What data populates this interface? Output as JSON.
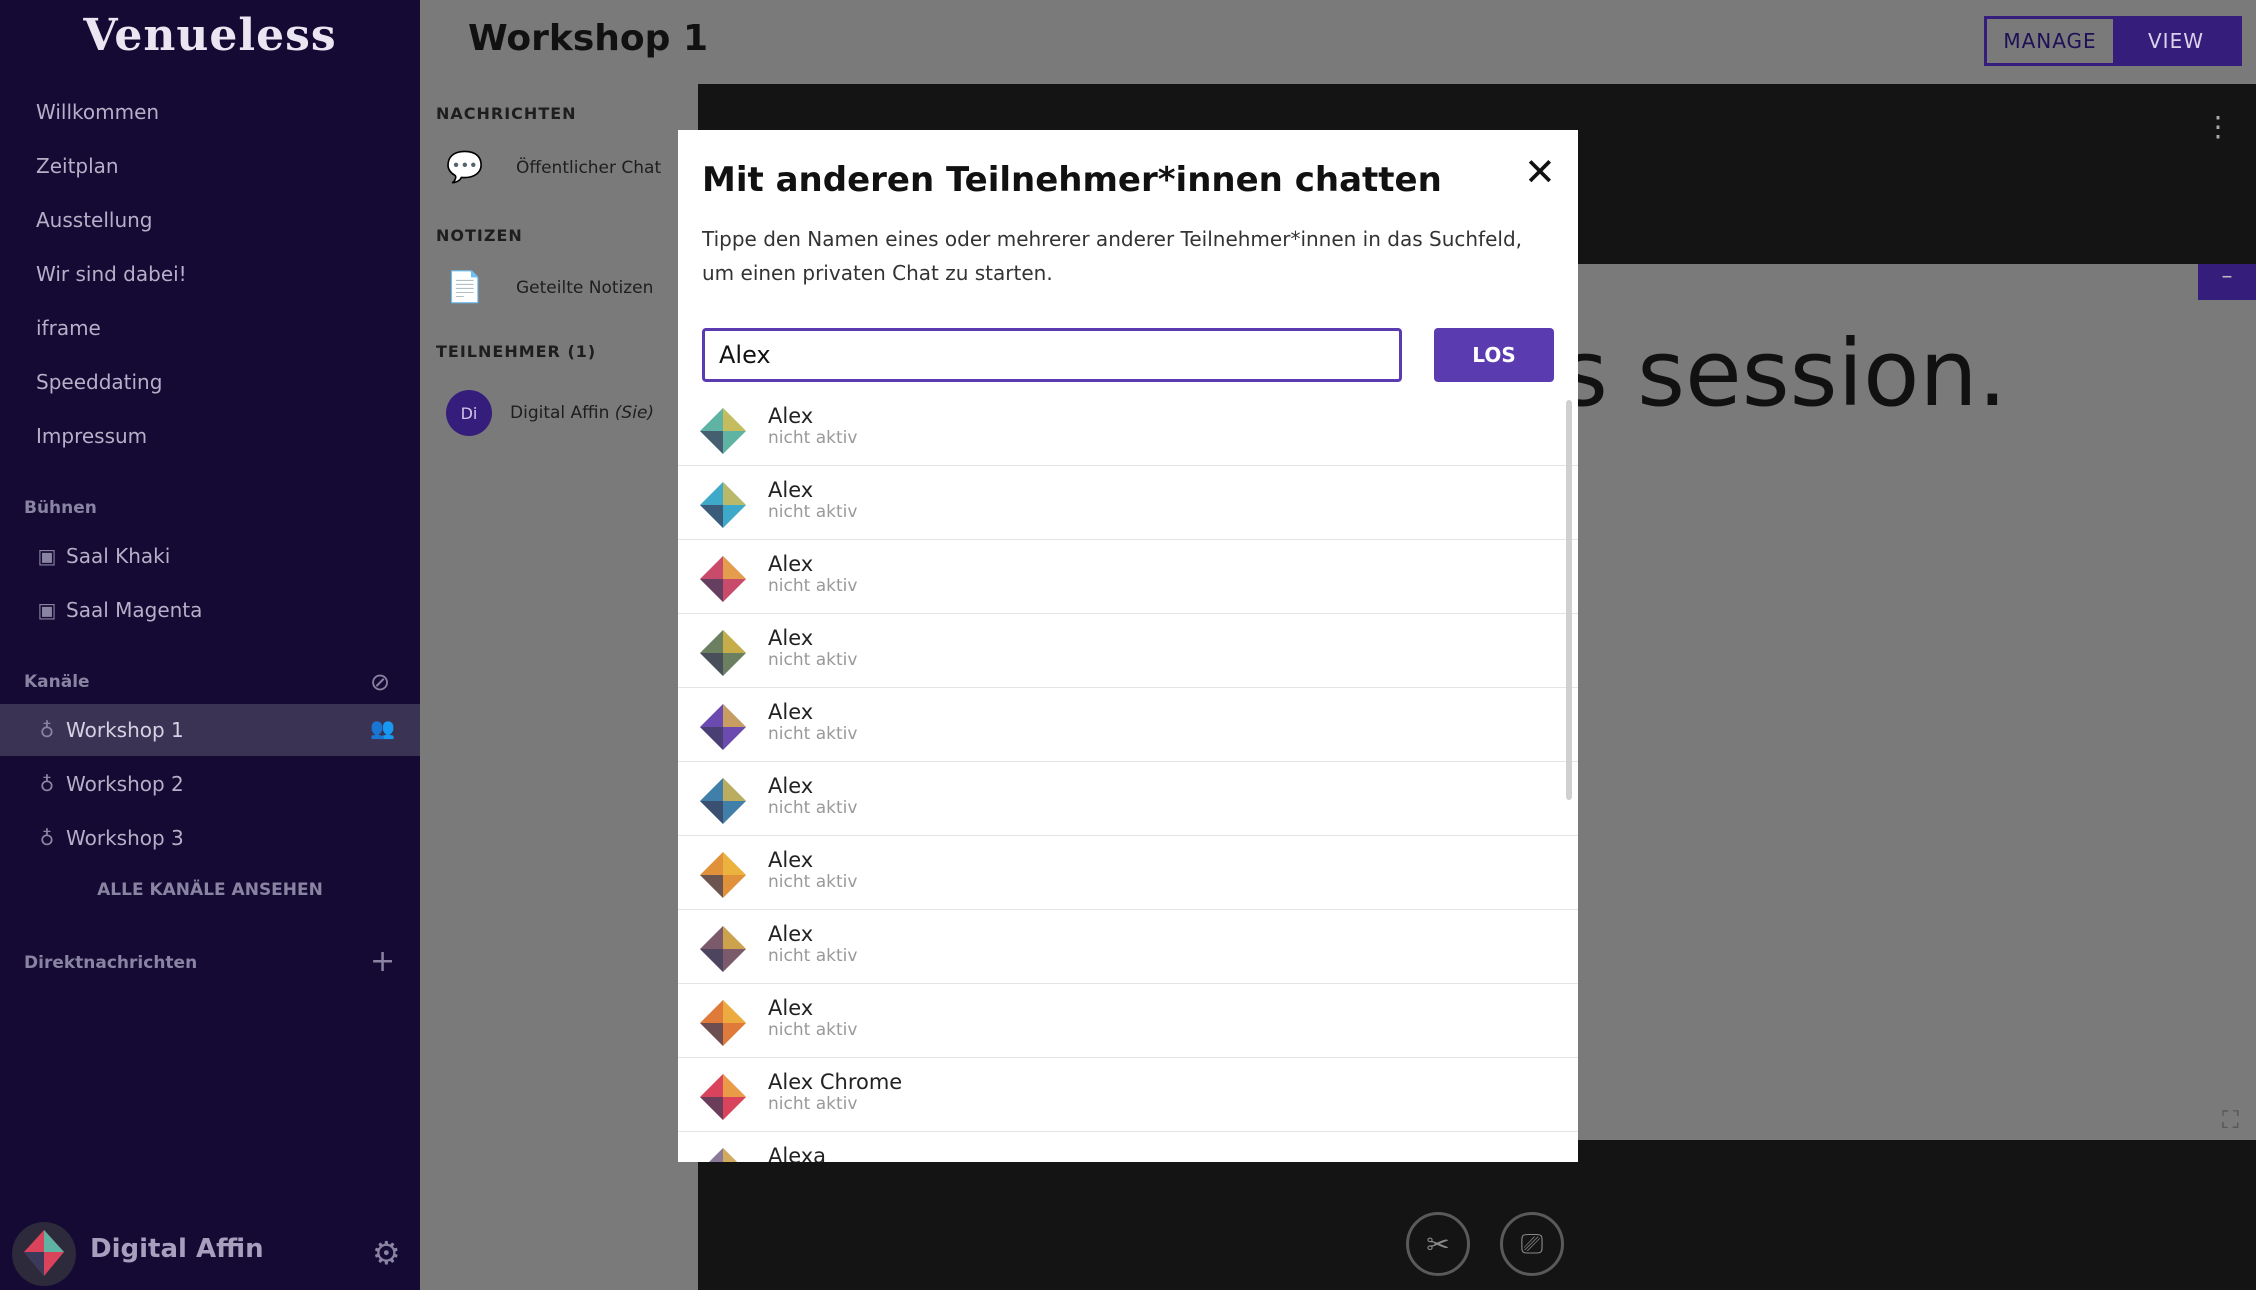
{
  "app": {
    "logo": "Venueless"
  },
  "sidebar": {
    "nav": [
      "Willkommen",
      "Zeitplan",
      "Ausstellung",
      "Wir sind dabei!",
      "iframe",
      "Speeddating",
      "Impressum"
    ],
    "stages_header": "Bühnen",
    "stages": [
      "Saal Khaki",
      "Saal Magenta"
    ],
    "channels_header": "Kanäle",
    "channels": [
      "Workshop 1",
      "Workshop 2",
      "Workshop 3"
    ],
    "all_channels": "ALLE KANÄLE ANSEHEN",
    "dm_header": "Direktnachrichten",
    "user": {
      "name": "Digital Affin"
    }
  },
  "header": {
    "title": "Workshop 1",
    "manage": "MANAGE",
    "view": "VIEW"
  },
  "panel": {
    "messages_header": "NACHRICHTEN",
    "public_chat": "Öffentlicher Chat",
    "notes_header": "NOTIZEN",
    "shared_notes": "Geteilte Notizen",
    "participants_header": "TEILNEHMER (1)",
    "participant": {
      "initials": "Di",
      "name": "Digital Affin",
      "you": "(Sie)"
    }
  },
  "stage": {
    "slide_text": "s session."
  },
  "modal": {
    "title": "Mit anderen Teilnehmer*innen chatten",
    "description": "Tippe den Namen eines oder mehrerer anderer Teilnehmer*innen in das Suchfeld, um einen privaten Chat zu starten.",
    "search_value": "Alex",
    "go": "LOS",
    "results": [
      {
        "name": "Alex",
        "status": "nicht aktiv",
        "color": "#5fb3a3"
      },
      {
        "name": "Alex",
        "status": "nicht aktiv",
        "color": "#3fa9c9"
      },
      {
        "name": "Alex",
        "status": "nicht aktiv",
        "color": "#c94b6b"
      },
      {
        "name": "Alex",
        "status": "nicht aktiv",
        "color": "#6a8060"
      },
      {
        "name": "Alex",
        "status": "nicht aktiv",
        "color": "#6b4bb0"
      },
      {
        "name": "Alex",
        "status": "nicht aktiv",
        "color": "#3f7fa9"
      },
      {
        "name": "Alex",
        "status": "nicht aktiv",
        "color": "#e0913a"
      },
      {
        "name": "Alex",
        "status": "nicht aktiv",
        "color": "#7a5a6b"
      },
      {
        "name": "Alex",
        "status": "nicht aktiv",
        "color": "#e07a3a"
      },
      {
        "name": "Alex Chrome",
        "status": "nicht aktiv",
        "color": "#d9435b"
      },
      {
        "name": "Alexa",
        "status": "",
        "color": "#8a7a9a"
      }
    ]
  }
}
